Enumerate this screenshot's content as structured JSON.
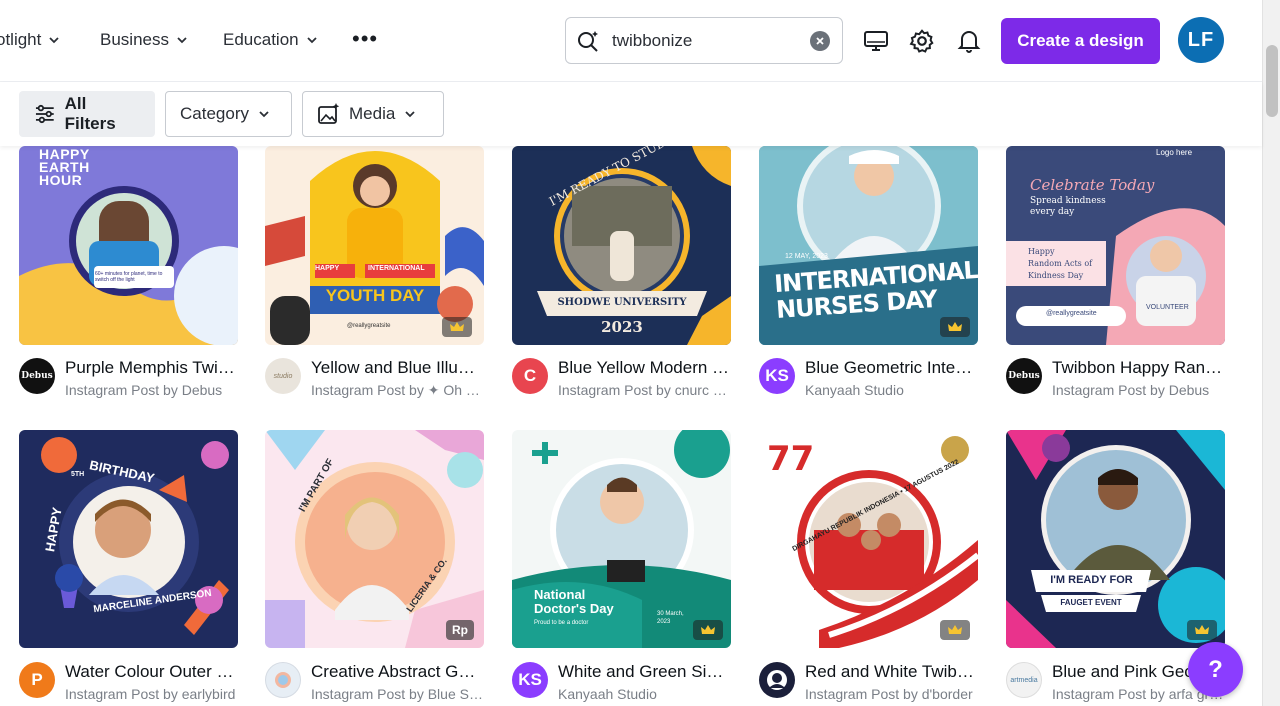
{
  "nav": {
    "items": [
      {
        "label": "otlight"
      },
      {
        "label": "Business"
      },
      {
        "label": "Education"
      }
    ],
    "more_label": "•••"
  },
  "search": {
    "value": "twibbonize",
    "placeholder": "Search"
  },
  "header": {
    "create_label": "Create a design",
    "avatar_initials": "LF"
  },
  "filters": {
    "all_label": "All Filters",
    "category_label": "Category",
    "media_label": "Media"
  },
  "help_label": "?",
  "row1": [
    {
      "title": "Purple Memphis Twibbon Earth Hour",
      "subtitle": "Instagram Post by Debus",
      "avatar": "Debus",
      "avatar_color": "#111111",
      "thumb_text": [
        "HAPPY",
        "EARTH",
        "HOUR"
      ],
      "caption": "60+ minutes for planet, time to switch off the light"
    },
    {
      "title": "Yellow and Blue Illustrated Youth Day",
      "subtitle": "Instagram Post by ✦ Oh Studio",
      "avatar": "studio",
      "avatar_color": "#e9e4dc",
      "thumb_text": [
        "HAPPY",
        "INTERNATIONAL",
        "YOUTH DAY"
      ],
      "caption": "@reallygreatsite"
    },
    {
      "title": "Blue Yellow Modern Graduation",
      "subtitle": "Instagram Post by cnurc design",
      "avatar": "C",
      "avatar_color": "#e8454f",
      "thumb_text": [
        "I'M READY TO STUDY AT",
        "SHODWE UNIVERSITY",
        "2023"
      ]
    },
    {
      "title": "Blue Geometric International Nurses Day",
      "subtitle": "Kanyaah Studio",
      "avatar": "KS",
      "avatar_color": "#8b3dff",
      "thumb_text": [
        "12 MAY, 2023",
        "INTERNATIONAL",
        "NURSES DAY"
      ]
    },
    {
      "title": "Twibbon Happy Random Acts of Kindness",
      "subtitle": "Instagram Post by Debus",
      "avatar": "Debus",
      "avatar_color": "#111111",
      "thumb_text": [
        "Logo here",
        "Celebrate Today",
        "Spread kindness",
        "every day",
        "Happy",
        "Random Acts of",
        "Kindness Day",
        "@reallygreatsite",
        "VOLUNTEER"
      ]
    }
  ],
  "row2": [
    {
      "title": "Water Colour Outer Space Birthday",
      "subtitle": "Instagram Post by earlybird",
      "avatar": "P",
      "avatar_color": "#f07a1a",
      "thumb_text": [
        "HAPPY",
        "BIRTHDAY",
        "5TH",
        "MARCELINE ANDERSON"
      ]
    },
    {
      "title": "Creative Abstract Geometric Twibbon",
      "subtitle": "Instagram Post by Blue Studio",
      "avatar": "",
      "avatar_color": "#e7eef5",
      "thumb_text": [
        "I'M PART OF",
        "LICERIA & CO."
      ],
      "badge": "Rp"
    },
    {
      "title": "White and Green Simple Doctor's Day",
      "subtitle": "Kanyaah Studio",
      "avatar": "KS",
      "avatar_color": "#8b3dff",
      "thumb_text": [
        "National",
        "Doctor's Day",
        "Proud to be a doctor",
        "30 March,",
        "2023"
      ]
    },
    {
      "title": "Red and White Twibbon Indonesia",
      "subtitle": "Instagram Post by d'border",
      "avatar": "",
      "avatar_color": "#1b1f3a",
      "thumb_text": [
        "DIRGAHAYU REPUBLIK INDONESIA • 17 AGUSTUS 2022"
      ]
    },
    {
      "title": "Blue and Pink Geometric Twibbon",
      "subtitle": "Instagram Post by arfa graphic",
      "avatar": "artmedia",
      "avatar_color": "#f2f2f2",
      "thumb_text": [
        "I'M READY FOR",
        "FAUGET EVENT"
      ]
    }
  ],
  "colors": {
    "accent": "#7d2ae8",
    "avatar_bg": "#0c6eb3"
  }
}
